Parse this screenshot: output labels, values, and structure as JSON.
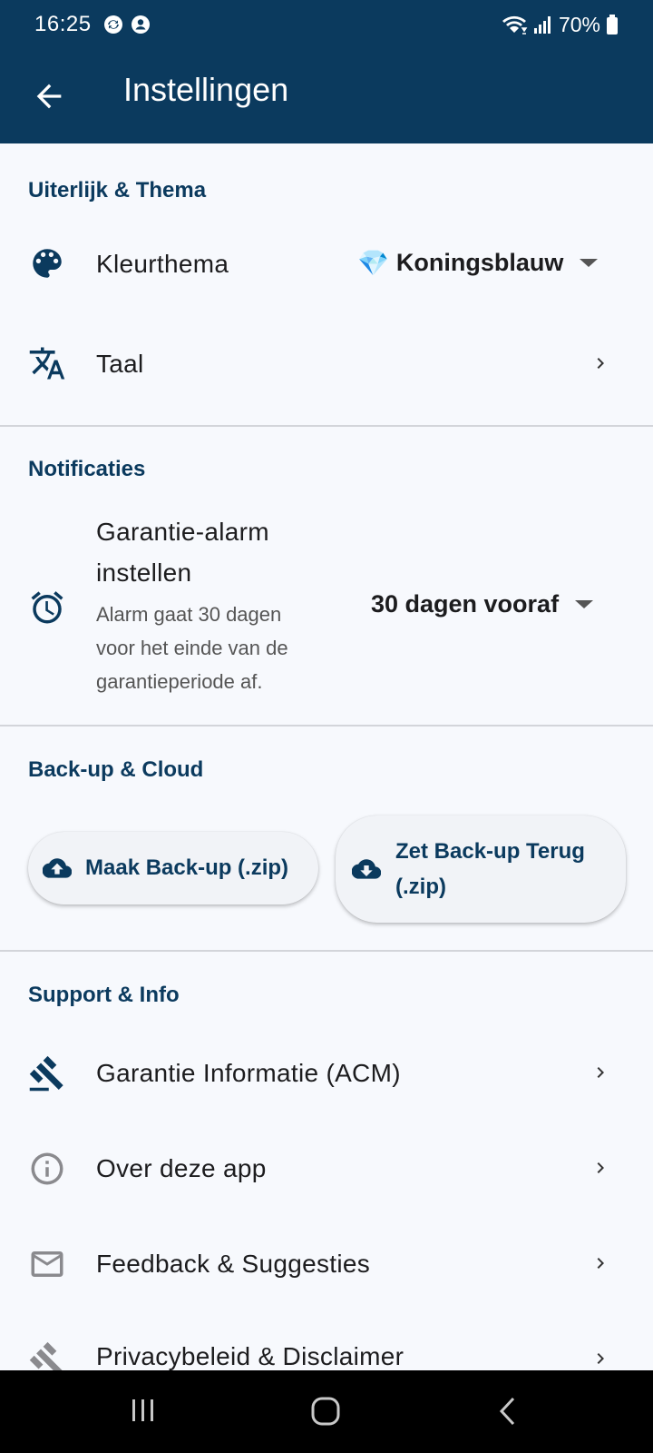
{
  "status_bar": {
    "time": "16:25",
    "battery": "70%"
  },
  "app_bar": {
    "title": "Instellingen"
  },
  "appearance": {
    "header": "Uiterlijk & Thema",
    "color_theme": {
      "label": "Kleurthema",
      "value": "Koningsblauw",
      "gem": "💎"
    },
    "language": {
      "label": "Taal"
    }
  },
  "notifications": {
    "header": "Notificaties",
    "alarm": {
      "label_line1": "Garantie-alarm",
      "label_line2": "instellen",
      "desc_line1": "Alarm gaat 30 dagen",
      "desc_line2": "voor het einde van de",
      "desc_line3": "garantieperiode af.",
      "value": "30 dagen vooraf"
    }
  },
  "backup": {
    "header": "Back-up & Cloud",
    "make_label": "Maak Back-up (.zip)",
    "restore_line1": "Zet Back-up Terug",
    "restore_line2": "(.zip)"
  },
  "support": {
    "header": "Support & Info",
    "items": [
      {
        "label": "Garantie Informatie (ACM)"
      },
      {
        "label": "Over deze app"
      },
      {
        "label": "Feedback & Suggesties"
      },
      {
        "label": "Privacybeleid & Disclaimer"
      }
    ]
  },
  "colors": {
    "primary": "#0b3a5e",
    "background": "#f7f9fd",
    "divider": "#d3d5da"
  }
}
